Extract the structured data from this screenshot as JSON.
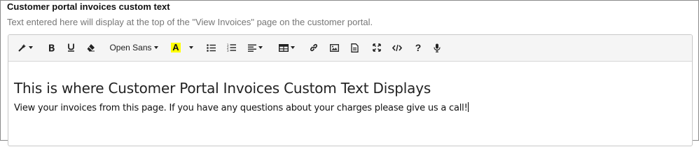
{
  "field": {
    "label": "Customer portal invoices custom text",
    "help": "Text entered here will display at the top of the \"View Invoices\" page on the customer portal."
  },
  "toolbar": {
    "font_family": "Open Sans",
    "highlight_label": "A",
    "highlight_color": "#ffff00",
    "help_label": "?",
    "items": [
      "magic-style-icon",
      "bold-icon",
      "underline-icon",
      "eraser-icon",
      "font-family-select",
      "highlight-color-icon",
      "unordered-list-icon",
      "ordered-list-icon",
      "align-icon",
      "table-icon",
      "link-icon",
      "image-icon",
      "file-icon",
      "fullscreen-icon",
      "code-view-icon",
      "help-icon",
      "microphone-icon"
    ]
  },
  "content": {
    "heading": "This is where Customer Portal Invoices Custom Text Displays",
    "paragraph": "View your invoices from this page. If you have any questions about your charges please give us a call!"
  }
}
